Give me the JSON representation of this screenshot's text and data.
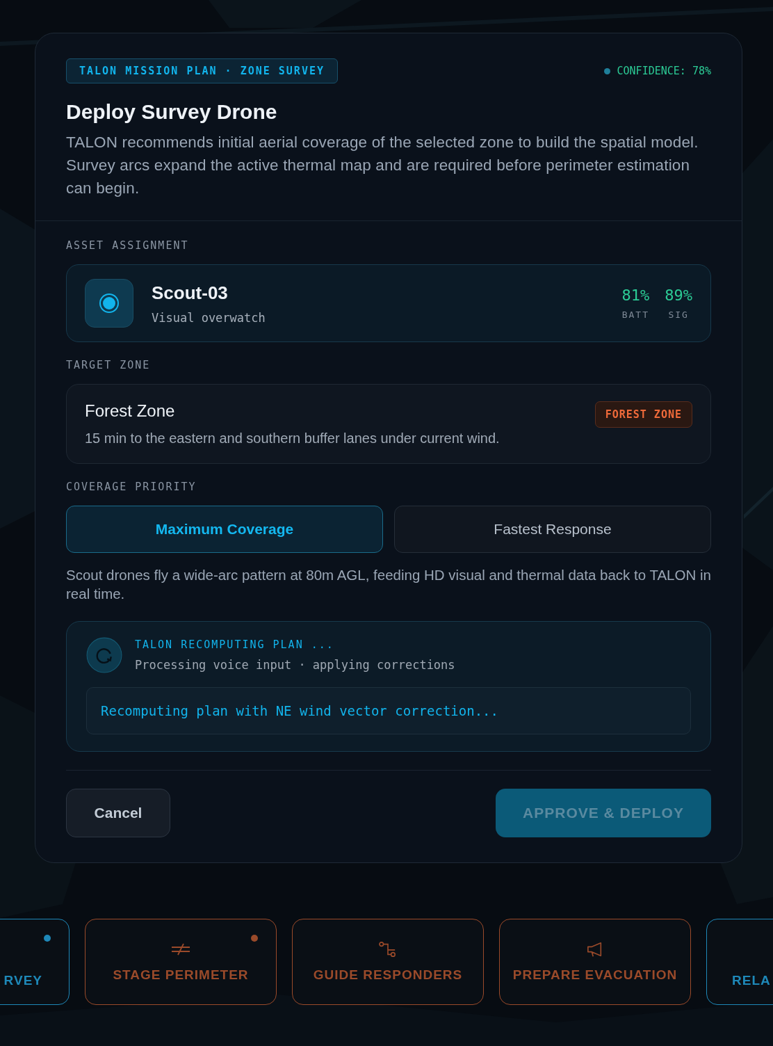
{
  "modal": {
    "tag": "TALON MISSION PLAN · ZONE SURVEY",
    "confidence": "CONFIDENCE: 78%",
    "title": "Deploy Survey Drone",
    "description": "TALON recommends initial aerial coverage of the selected zone to build the spatial model. Survey arcs expand the active thermal map and are required before perimeter estimation can begin.",
    "asset_section": "ASSET ASSIGNMENT",
    "asset": {
      "name": "Scout-03",
      "role": "Visual overwatch",
      "stats": [
        {
          "value": "81%",
          "label": "BATT"
        },
        {
          "value": "89%",
          "label": "SIG"
        }
      ]
    },
    "zone_section": "TARGET ZONE",
    "zone": {
      "name": "Forest Zone",
      "detail": "15 min to the eastern and southern buffer lanes under current wind.",
      "badge": "FOREST ZONE"
    },
    "priority_section": "COVERAGE PRIORITY",
    "priority_options": [
      {
        "label": "Maximum Coverage",
        "selected": true
      },
      {
        "label": "Fastest Response",
        "selected": false
      }
    ],
    "priority_note": "Scout drones fly a wide-arc pattern at 80m AGL, feeding HD visual and thermal data back to TALON in real time.",
    "status": {
      "title": "TALON RECOMPUTING PLAN ...",
      "subtitle": "Processing voice input · applying corrections",
      "message": "Recomputing plan with NE wind vector correction..."
    },
    "buttons": [
      {
        "label": "Cancel",
        "kind": "secondary",
        "disabled": false
      },
      {
        "label": "APPROVE & DEPLOY",
        "kind": "primary",
        "disabled": true
      }
    ]
  },
  "action_cards": [
    {
      "label": "RVEY",
      "color": "#1e88b8",
      "dot": true,
      "kind": "plain"
    },
    {
      "label": "STAGE PERIMETER",
      "color": "#9a4a2a",
      "dot": true,
      "kind": "perimeter"
    },
    {
      "label": "GUIDE RESPONDERS",
      "color": "#9a4a2a",
      "dot": false,
      "kind": "route"
    },
    {
      "label": "PREPARE EVACUATION",
      "color": "#9a4a2a",
      "dot": false,
      "kind": "megaphone"
    },
    {
      "label": "RELA",
      "color": "#1e88b8",
      "dot": false,
      "kind": "plain"
    }
  ]
}
